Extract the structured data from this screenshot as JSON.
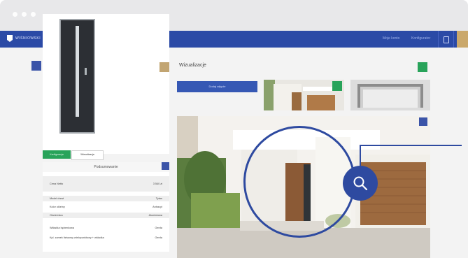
{
  "header": {
    "brand": "WIŚNIOWSKI",
    "nav": [
      "Moje konto",
      "Konfigurator"
    ]
  },
  "left": {
    "tabs": [
      "Konfiguracja",
      "Wizualizacja"
    ],
    "summary": {
      "title": "Podsumowanie",
      "price_label": "Cena Netto",
      "price": "3 540 zł",
      "rows": [
        {
          "label": "Model drzwi",
          "value": "Tytan"
        },
        {
          "label": "Kolor okleiny",
          "value": "Antracyt"
        },
        {
          "label": "Ościeżnica",
          "value": "Aluminiowa"
        },
        {
          "label": "Wkładka bębenkowa",
          "value": "Gerda"
        },
        {
          "label": "Kpl. zamek listwowy wielopunktowy + wkładka",
          "value": "Gerda"
        }
      ]
    }
  },
  "main": {
    "title": "Wizualizacje",
    "cta_label": "Dodaj zdjęcie",
    "magnifier": "search-icon"
  },
  "colors": {
    "navbar": "#2b4aa6",
    "accent_green": "#28a35a",
    "accent_blue": "#3b54a8",
    "accent_tan": "#c2a572"
  }
}
